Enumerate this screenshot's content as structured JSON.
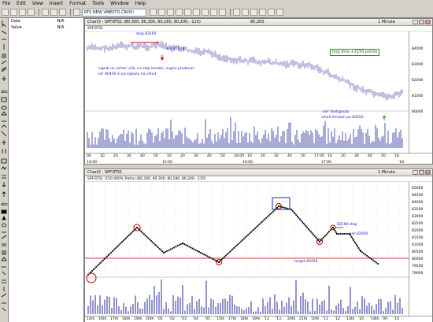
{
  "menu": [
    "File",
    "Edit",
    "View",
    "Insert",
    "Format",
    "Tools",
    "Window",
    "Help"
  ],
  "toolbar": {
    "symbol": "RTS NEW VMESTO CROS!"
  },
  "data_window": {
    "rows": [
      {
        "key": "Date",
        "value": "N/A"
      },
      {
        "key": "Value",
        "value": "N/A"
      }
    ]
  },
  "chart3": {
    "title": "Chart3 - SPF.RTS1 (80,300, 80,300, 80,180, 80,200, -110)",
    "title_mid": "80,200",
    "interval": "1 Minute",
    "pane": "SPF.RTS1",
    "price_ticks": [
      "84000",
      "83000",
      "82000",
      "81000",
      "80000"
    ],
    "time_top": [
      "00",
      "10",
      "20",
      "30",
      "40",
      "50",
      "10",
      "20",
      "30",
      "40",
      "50",
      "16:00",
      "10",
      "20",
      "30",
      "40",
      "50",
      "17:00",
      "10",
      "20",
      "30",
      "40",
      "50",
      "18"
    ],
    "time_sub": {
      "left": "14:00",
      "mid1": "15:00",
      "mid2": "16:00",
      "mid3": "17:00",
      "right": "'18"
    },
    "annotations": {
      "stop": "stop 83160",
      "sell": "sell 82600",
      "signal_line1": "'signal na vchan' sl/b, no stop korotki, nugno prodavat",
      "signal_line2": "cel' 80450 iii po signalu na vihod",
      "profit": "itog dnia +2150 points",
      "target_line1": "cel' dostignuta",
      "target_line2": "vihod limitom po 80450"
    }
  },
  "chart2": {
    "title": "Chart2 - SPF.RTS1",
    "interval": "1 Minute",
    "pane": "SPF.RTS1 (150.000% Ratio) (80,300, 80,300, 80,180, 80,200, -110)",
    "price_ticks": [
      "85000",
      "84500",
      "84000",
      "83500",
      "83000",
      "82500",
      "82000",
      "81500",
      "81000",
      "80500",
      "80000",
      "79500",
      "79000"
    ],
    "time_labels": [
      "14th",
      "16th",
      "17th",
      "18th",
      "19th",
      "20th",
      "'01",
      "'02",
      "'03",
      "'04",
      "'05",
      "15th",
      "17th",
      "18th",
      "19th",
      "'12",
      "'13",
      "20th",
      "21th",
      "10th",
      "'11",
      "'12",
      "13th",
      "'16",
      "'18th",
      "'09",
      "'10"
    ],
    "annotations": {
      "stop": "83160 stop",
      "sell": "sell 82600",
      "target": "target 80450"
    }
  },
  "colors": {
    "bars": "#2a2a9a",
    "red": "#c00000",
    "green": "#1f9a1f",
    "blue": "#2020c0"
  }
}
